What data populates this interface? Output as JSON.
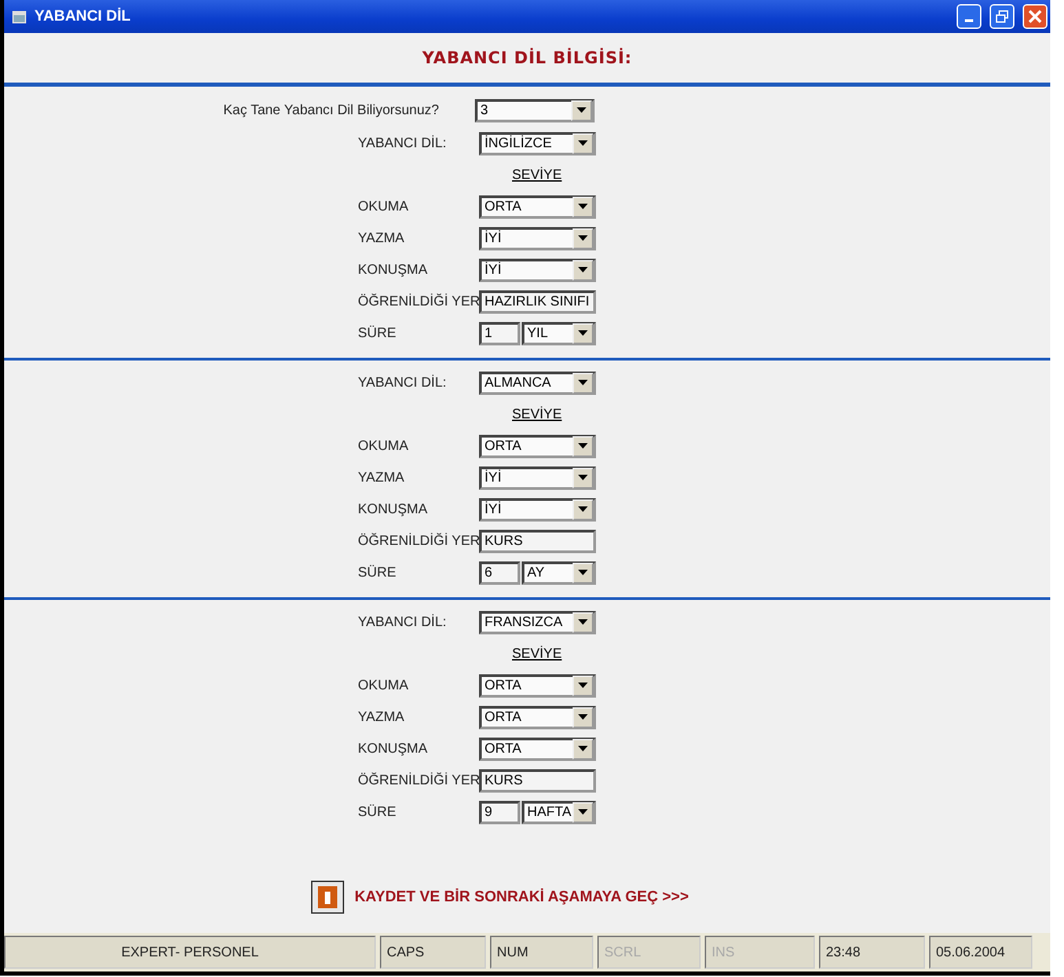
{
  "window": {
    "title": "YABANCI DİL"
  },
  "heading": "YABANCI DİL BİLGİSİ:",
  "count": {
    "label": "Kaç Tane Yabancı Dil Biliyorsunuz?",
    "value": "3"
  },
  "languages": [
    {
      "language": {
        "label": "YABANCI DİL:",
        "value": "İNGİLİZCE"
      },
      "level_heading": "SEVİYE",
      "rows": [
        {
          "kind": "select",
          "label": "OKUMA",
          "value": "ORTA"
        },
        {
          "kind": "select",
          "label": "YAZMA",
          "value": "İYİ"
        },
        {
          "kind": "select",
          "label": "KONUŞMA",
          "value": "İYİ"
        },
        {
          "kind": "text",
          "label": "ÖĞRENİLDİĞİ YER",
          "value": "HAZIRLIK SINIFI"
        },
        {
          "kind": "duration",
          "label": "SÜRE",
          "value": "1",
          "unit": "YIL"
        }
      ]
    },
    {
      "language": {
        "label": "YABANCI DİL:",
        "value": "ALMANCA"
      },
      "level_heading": "SEVİYE",
      "rows": [
        {
          "kind": "select",
          "label": "OKUMA",
          "value": "ORTA"
        },
        {
          "kind": "select",
          "label": "YAZMA",
          "value": "İYİ"
        },
        {
          "kind": "select",
          "label": "KONUŞMA",
          "value": "İYİ"
        },
        {
          "kind": "text",
          "label": "ÖĞRENİLDİĞİ YER",
          "value": "KURS"
        },
        {
          "kind": "duration",
          "label": "SÜRE",
          "value": "6",
          "unit": "AY"
        }
      ]
    },
    {
      "language": {
        "label": "YABANCI DİL:",
        "value": "FRANSIZCA"
      },
      "level_heading": "SEVİYE",
      "rows": [
        {
          "kind": "select",
          "label": "OKUMA",
          "value": "ORTA"
        },
        {
          "kind": "select",
          "label": "YAZMA",
          "value": "ORTA"
        },
        {
          "kind": "select",
          "label": "KONUŞMA",
          "value": "ORTA"
        },
        {
          "kind": "text",
          "label": "ÖĞRENİLDİĞİ YER",
          "value": "KURS"
        },
        {
          "kind": "duration",
          "label": "SÜRE",
          "value": "9",
          "unit": "HAFTA"
        }
      ]
    }
  ],
  "save_button": {
    "label": "KAYDET VE BİR SONRAKİ AŞAMAYA GEÇ >>>"
  },
  "status_bar": [
    {
      "text": "EXPERT- PERSONEL",
      "disabled": false
    },
    {
      "text": "CAPS",
      "disabled": false
    },
    {
      "text": "NUM",
      "disabled": false
    },
    {
      "text": "SCRL",
      "disabled": true
    },
    {
      "text": "INS",
      "disabled": true
    },
    {
      "text": "23:48",
      "disabled": false
    },
    {
      "text": "05.06.2004",
      "disabled": false
    }
  ]
}
